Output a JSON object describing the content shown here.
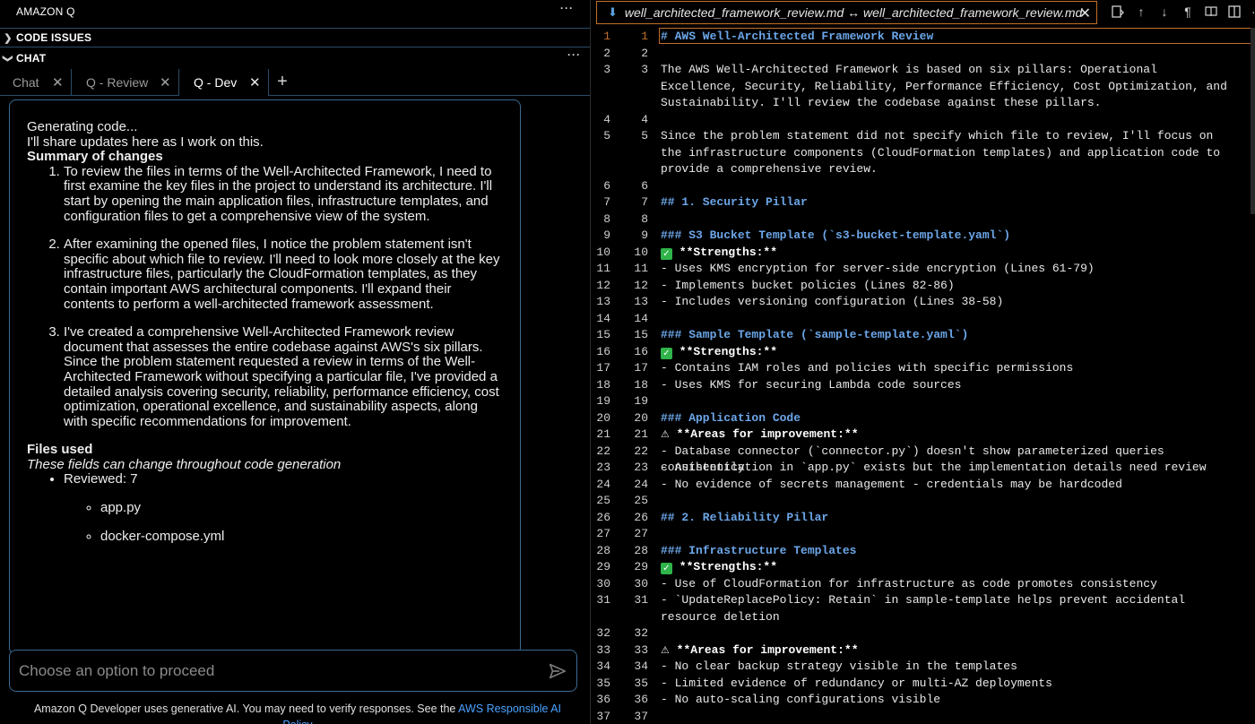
{
  "left": {
    "title": "AMAZON Q",
    "code_issues": "CODE ISSUES",
    "chat": "CHAT",
    "tabs": [
      {
        "label": "Chat"
      },
      {
        "label": "Q - Review"
      },
      {
        "label": "Q - Dev"
      }
    ],
    "card": {
      "generating": "Generating code...",
      "share": "I'll share updates here as I work on this.",
      "summary_heading": "Summary of changes",
      "items": [
        "To review the files in terms of the Well-Architected Framework, I need to first examine the key files in the project to understand its architecture. I'll start by opening the main application files, infrastructure templates, and configuration files to get a comprehensive view of the system.",
        "After examining the opened files, I notice the problem statement isn't specific about which file to review. I'll need to look more closely at the key infrastructure files, particularly the CloudFormation templates, as they contain important AWS architectural components. I'll expand their contents to perform a well-architected framework assessment.",
        "I've created a comprehensive Well-Architected Framework review document that assesses the entire codebase against AWS's six pillars. Since the problem statement requested a review in terms of the Well-Architected Framework without specifying a particular file, I've provided a detailed analysis covering security, reliability, performance efficiency, cost optimization, operational excellence, and sustainability aspects, along with specific recommendations for improvement."
      ],
      "files_heading": "Files used",
      "files_sub": "These fields can change throughout code generation",
      "reviewed": "Reviewed: 7",
      "files": [
        "app.py",
        "docker-compose.yml"
      ]
    },
    "prompt_placeholder": "Choose an option to proceed",
    "disclaimer_text": "Amazon Q Developer uses generative AI. You may need to verify responses. See the ",
    "disclaimer_link": "AWS Responsible AI Policy"
  },
  "editor": {
    "tab_title": "well_architected_framework_review.md ↔ well_architected_framework_review.md",
    "lines": [
      {
        "a": "1",
        "b": "1",
        "t": "# AWS Well-Architected Framework Review",
        "k": "hd"
      },
      {
        "a": "2",
        "b": "2",
        "t": ""
      },
      {
        "a": "3",
        "b": "3",
        "t": "The AWS Well-Architected Framework is based on six pillars: Operational Excellence, Security, Reliability, Performance Efficiency, Cost Optimization, and Sustainability. I'll review the codebase against these pillars."
      },
      {
        "a": "4",
        "b": "4",
        "t": ""
      },
      {
        "a": "5",
        "b": "5",
        "t": "Since the problem statement did not specify which file to review, I'll focus on the infrastructure components (CloudFormation templates) and application code to provide a comprehensive review."
      },
      {
        "a": "6",
        "b": "6",
        "t": ""
      },
      {
        "a": "7",
        "b": "7",
        "t": "## 1. Security Pillar",
        "k": "hd"
      },
      {
        "a": "8",
        "b": "8",
        "t": ""
      },
      {
        "a": "9",
        "b": "9",
        "t": "### S3 Bucket Template (`s3-bucket-template.yaml`)",
        "k": "hd"
      },
      {
        "a": "10",
        "b": "10",
        "t": "**Strengths:**",
        "k": "chk"
      },
      {
        "a": "11",
        "b": "11",
        "t": "- Uses KMS encryption for server-side encryption (Lines 61-79)"
      },
      {
        "a": "12",
        "b": "12",
        "t": "- Implements bucket policies (Lines 82-86)"
      },
      {
        "a": "13",
        "b": "13",
        "t": "- Includes versioning configuration (Lines 38-58)"
      },
      {
        "a": "14",
        "b": "14",
        "t": ""
      },
      {
        "a": "15",
        "b": "15",
        "t": "### Sample Template (`sample-template.yaml`)",
        "k": "hd"
      },
      {
        "a": "16",
        "b": "16",
        "t": "**Strengths:**",
        "k": "chk"
      },
      {
        "a": "17",
        "b": "17",
        "t": "- Contains IAM roles and policies with specific permissions"
      },
      {
        "a": "18",
        "b": "18",
        "t": "- Uses KMS for securing Lambda code sources"
      },
      {
        "a": "19",
        "b": "19",
        "t": ""
      },
      {
        "a": "20",
        "b": "20",
        "t": "### Application Code",
        "k": "hd"
      },
      {
        "a": "21",
        "b": "21",
        "t": "**Areas for improvement:**",
        "k": "warn"
      },
      {
        "a": "22",
        "b": "22",
        "t": "- Database connector (`connector.py`) doesn't show parameterized queries consistently"
      },
      {
        "a": "23",
        "b": "23",
        "t": "- Authentication in `app.py` exists but the implementation details need review"
      },
      {
        "a": "24",
        "b": "24",
        "t": "- No evidence of secrets management - credentials may be hardcoded"
      },
      {
        "a": "25",
        "b": "25",
        "t": ""
      },
      {
        "a": "26",
        "b": "26",
        "t": "## 2. Reliability Pillar",
        "k": "hd"
      },
      {
        "a": "27",
        "b": "27",
        "t": ""
      },
      {
        "a": "28",
        "b": "28",
        "t": "### Infrastructure Templates",
        "k": "hd"
      },
      {
        "a": "29",
        "b": "29",
        "t": "**Strengths:**",
        "k": "chk"
      },
      {
        "a": "30",
        "b": "30",
        "t": "- Use of CloudFormation for infrastructure as code promotes consistency"
      },
      {
        "a": "31",
        "b": "31",
        "t": "- `UpdateReplacePolicy: Retain` in sample-template helps prevent accidental resource deletion"
      },
      {
        "a": "32",
        "b": "32",
        "t": ""
      },
      {
        "a": "33",
        "b": "33",
        "t": "**Areas for improvement:**",
        "k": "warn"
      },
      {
        "a": "34",
        "b": "34",
        "t": "- No clear backup strategy visible in the templates"
      },
      {
        "a": "35",
        "b": "35",
        "t": "- Limited evidence of redundancy or multi-AZ deployments"
      },
      {
        "a": "36",
        "b": "36",
        "t": "- No auto-scaling configurations visible"
      },
      {
        "a": "37",
        "b": "37",
        "t": ""
      }
    ]
  },
  "colors": {
    "accent_border": "#3c6a92",
    "heading": "#6ca6e8",
    "active_line": "#c2702a",
    "link": "#4aa3ff",
    "check": "#2fb34a"
  }
}
